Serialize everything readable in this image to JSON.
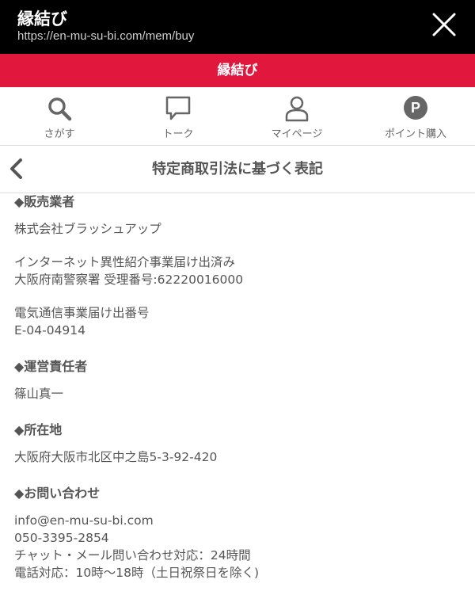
{
  "browser": {
    "title": "縁結び",
    "url": "https://en-mu-su-bi.com/mem/buy"
  },
  "brand": "縁結び",
  "nav": {
    "items": [
      {
        "label": "さがす",
        "icon": "search-icon"
      },
      {
        "label": "トーク",
        "icon": "speech-bubble-icon"
      },
      {
        "label": "マイページ",
        "icon": "person-icon"
      },
      {
        "label": "ポイント購入",
        "icon": "point-p-icon"
      }
    ]
  },
  "page": {
    "title": "特定商取引法に基づく表記"
  },
  "sections": {
    "seller": {
      "title": "◆販売業者",
      "company": "株式会社ブラッシュアップ",
      "notice_line1": "インターネット異性紹介事業届け出済み",
      "notice_line2": "大阪府南警察署 受理番号:62220016000",
      "telecom_label": "電気通信事業届け出番号",
      "telecom_number": "E-04-04914"
    },
    "manager": {
      "title": "◆運営責任者",
      "name": "篠山真一"
    },
    "address": {
      "title": "◆所在地",
      "value": "大阪府大阪市北区中之島5-3-92-420"
    },
    "contact": {
      "title": "◆お問い合わせ",
      "email": "info@en-mu-su-bi.com",
      "phone": "050-3395-2854",
      "chat_hours": "チャット・メール問い合わせ対応：24時間",
      "phone_hours": "電話対応：10時～18時（土日祝祭日を除く)"
    }
  },
  "colors": {
    "brand_red": "#e1173e",
    "topbar_black": "#000000",
    "icon_gray": "#666666",
    "text_gray": "#555555"
  }
}
